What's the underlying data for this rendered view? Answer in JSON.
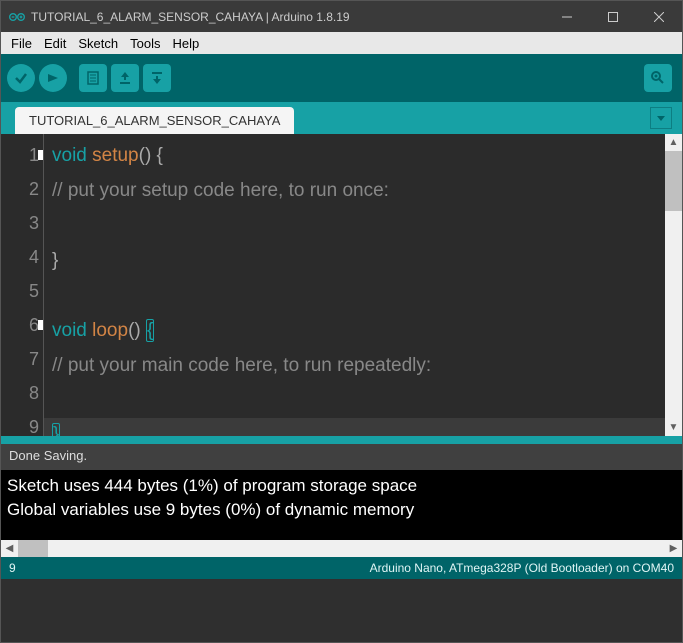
{
  "window": {
    "title": "TUTORIAL_6_ALARM_SENSOR_CAHAYA | Arduino 1.8.19"
  },
  "menu": {
    "file": "File",
    "edit": "Edit",
    "sketch": "Sketch",
    "tools": "Tools",
    "help": "Help"
  },
  "tab": {
    "name": "TUTORIAL_6_ALARM_SENSOR_CAHAYA"
  },
  "code": {
    "lines": [
      "1",
      "2",
      "3",
      "4",
      "5",
      "6",
      "7",
      "8",
      "9"
    ],
    "l1_kw": "void",
    "l1_fn": "setup",
    "l1_pn": "() {",
    "l2": "// put your setup code here, to run once:",
    "l4": "}",
    "l6_kw": "void",
    "l6_fn": "loop",
    "l6_pn": "() ",
    "l6_br": "{",
    "l7": "// put your main code here, to run repeatedly:",
    "l9_br": "}"
  },
  "status": {
    "message": "Done Saving."
  },
  "console": {
    "l1": "Sketch uses 444 bytes (1%) of program storage space",
    "l2": "Global variables use 9 bytes (0%) of dynamic memory"
  },
  "footer": {
    "cursor": "9",
    "board": "Arduino Nano, ATmega328P (Old Bootloader) on COM40"
  }
}
